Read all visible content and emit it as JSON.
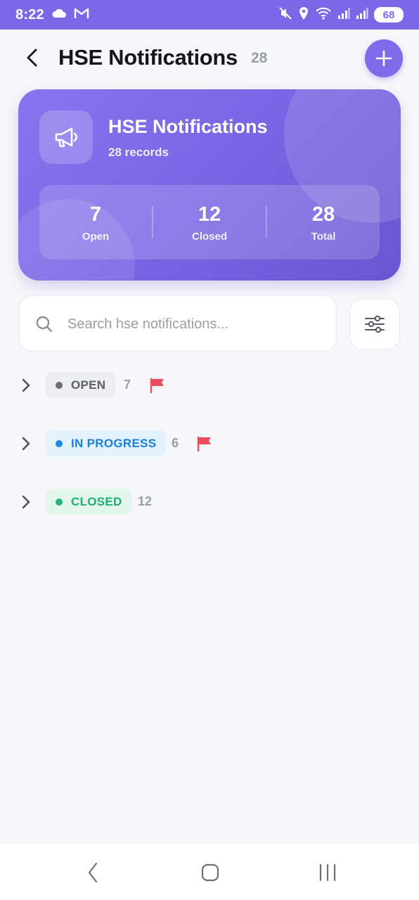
{
  "status_bar": {
    "time": "8:22",
    "battery": "68",
    "icons": [
      "cloud-icon",
      "gmail-icon",
      "mute-vibrate-icon",
      "location-icon",
      "wifi-icon",
      "signal-icon",
      "signal-icon",
      "battery-icon"
    ]
  },
  "header": {
    "title": "HSE Notifications",
    "count": "28",
    "back_icon": "back-arrow-icon",
    "add_icon": "plus-icon"
  },
  "hero": {
    "icon": "megaphone-icon",
    "title": "HSE Notifications",
    "subtitle": "28 records",
    "stats": [
      {
        "value": "7",
        "label": "Open"
      },
      {
        "value": "12",
        "label": "Closed"
      },
      {
        "value": "28",
        "label": "Total"
      }
    ]
  },
  "search": {
    "placeholder": "Search hse notifications...",
    "value": "",
    "icon": "search-icon",
    "filter_icon": "sliders-icon"
  },
  "groups": [
    {
      "label": "OPEN",
      "count": "7",
      "flagged": true,
      "dot_color": "#6b6e78",
      "text_color": "#5b5e68",
      "bg_color": "#eceef2"
    },
    {
      "label": "IN PROGRESS",
      "count": "6",
      "flagged": true,
      "dot_color": "#1e88e5",
      "text_color": "#1a7fd4",
      "bg_color": "#e4f2fd"
    },
    {
      "label": "CLOSED",
      "count": "12",
      "flagged": false,
      "dot_color": "#22b573",
      "text_color": "#1fae6c",
      "bg_color": "#e3f6ec"
    }
  ],
  "colors": {
    "accent": "#7c67e8",
    "flag": "#ea4d5c",
    "background": "#f6f7fa"
  },
  "nav_bar": {
    "icons": [
      "back-nav-icon",
      "home-nav-icon",
      "recents-nav-icon"
    ]
  }
}
